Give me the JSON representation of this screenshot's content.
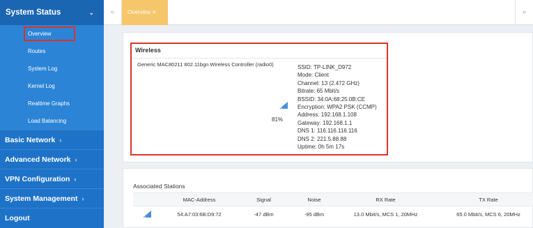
{
  "sidebar": {
    "section": {
      "label": "System Status",
      "chevron": "chevron-down-icon"
    },
    "sub_items": [
      {
        "label": "Overview",
        "active": true
      },
      {
        "label": "Routes"
      },
      {
        "label": "System Log"
      },
      {
        "label": "Kernel Log"
      },
      {
        "label": "Realtime Graphs"
      },
      {
        "label": "Load Balancing"
      }
    ],
    "main_items": [
      {
        "label": "Basic Network"
      },
      {
        "label": "Advanced Network"
      },
      {
        "label": "VPN Configuration"
      },
      {
        "label": "System Management"
      },
      {
        "label": "Logout"
      }
    ]
  },
  "tabs": {
    "prev_icon": "«",
    "next_icon": "»",
    "active": {
      "label": "Overview",
      "close": "✕"
    }
  },
  "wireless": {
    "title": "Wireless",
    "device": "Generic MAC80211 802.11bgn Wireless Controller (radio0)",
    "signal_percent": "81%",
    "info": [
      "SSID: TP-LINK_D972",
      "Mode: Client",
      "Channel: 13 (2.472 GHz)",
      "Bitrate: 65 Mbit/s",
      "BSSID: 34:0A:68:25:0B:CE",
      "Encryption: WPA2 PSK (CCMP)",
      "Address: 192.168.1.108",
      "Gateway: 192.168.1.1",
      "DNS 1: 116.116.116.116",
      "DNS 2: 221.5.88.88",
      "Uptime: 0h 5m 17s"
    ]
  },
  "stations": {
    "title": "Associated Stations",
    "headers": {
      "mac": "MAC-Address",
      "signal": "Signal",
      "noise": "Noise",
      "rx": "RX Rate",
      "tx": "TX Rate"
    },
    "rows": [
      {
        "mac": "54:A7:03:6B:D9:72",
        "signal": "-47 dBm",
        "noise": "-95 dBm",
        "rx": "13.0 Mbit/s, MCS 1, 20MHz",
        "tx": "65.0 Mbit/s, MCS 6, 20MHz"
      }
    ]
  },
  "colors": {
    "sidebar": "#1e73c8",
    "sidebar_sub": "#2c84d6",
    "tab_active": "#f6c66b",
    "highlight": "#d9342b"
  }
}
